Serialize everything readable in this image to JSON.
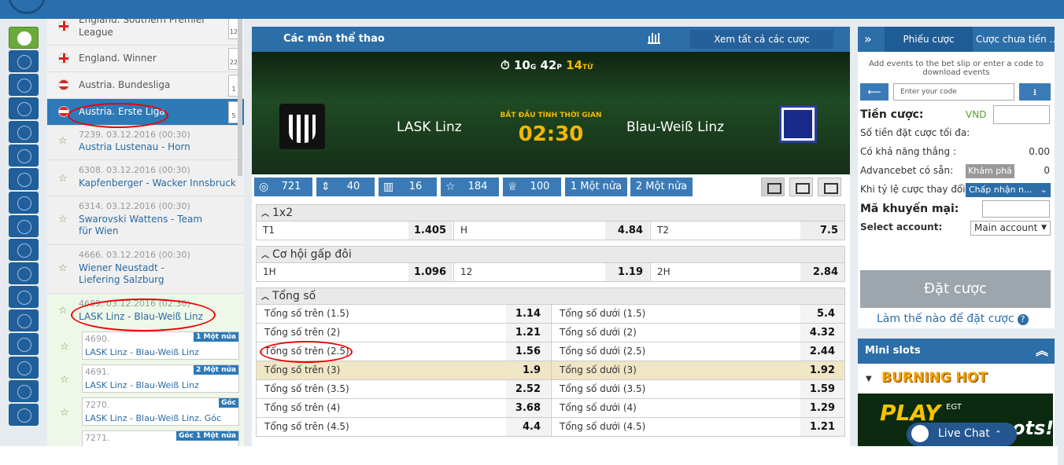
{
  "sidebar": {
    "flags": [
      "globe-icon",
      "uae-flag",
      "azerbaijan-flag",
      "belarus-flag",
      "bulgaria-flag",
      "czech-flag",
      "denmark-flag",
      "usa-flag",
      "germany-flag",
      "greece-flag",
      "england-flag",
      "spain-flag",
      "estonia-flag",
      "iran-flag",
      "finland-flag",
      "france-flag",
      "israel-flag"
    ],
    "leagues": [
      {
        "name": "England. Southern Premier League",
        "count": "12"
      },
      {
        "name": "England. Winner",
        "count": "22"
      },
      {
        "name": "Austria. Bundesliga",
        "count": "1"
      },
      {
        "name": "Austria. Erste Liga",
        "count": "5"
      }
    ],
    "matches": [
      {
        "id": "7239. 03.12.2016 (00:30)",
        "teams": "Austria Lustenau - Horn"
      },
      {
        "id": "6308. 03.12.2016 (00:30)",
        "teams": "Kapfenberger - Wacker Innsbruck"
      },
      {
        "id": "6314. 03.12.2016 (00:30)",
        "teams": "Swarovski Wattens - Team für Wien"
      },
      {
        "id": "4666. 03.12.2016 (00:30)",
        "teams": "Wiener Neustadt - Liefering Salzburg"
      },
      {
        "id": "4689. 03.12.2016 (02:30)",
        "teams": "LASK Linz - Blau-Weiß Linz"
      }
    ],
    "submarkets": [
      {
        "id": "4690.",
        "teams": "LASK Linz - Blau-Weiß Linz",
        "badge": "1 Một nửa"
      },
      {
        "id": "4691.",
        "teams": "LASK Linz - Blau-Weiß Linz",
        "badge": "2 Một nửa"
      },
      {
        "id": "7270.",
        "teams": "LASK Linz - Blau-Weiß Linz. Góc",
        "badge": "Góc"
      },
      {
        "id": "7271.",
        "teams": "",
        "badge": "Góc 1 Một nửa"
      }
    ]
  },
  "center": {
    "title": "Các môn thể thao",
    "view_all": "Xem tất cả các cược",
    "countdown": {
      "hours": "10",
      "h_unit": "G",
      "minutes": "42",
      "m_unit": "P",
      "seconds": "14",
      "s_unit": "TỪ"
    },
    "home_team": "LASK Linz",
    "away_team": "Blau-Weiß Linz",
    "start_label": "BẮT ĐẦU TÍNH THỜI GIAN",
    "start_time": "02:30",
    "tabs": [
      {
        "icon": "target-icon",
        "label": "721"
      },
      {
        "icon": "updown-icon",
        "label": "40"
      },
      {
        "icon": "bars-icon",
        "label": "16"
      },
      {
        "icon": "star-icon",
        "label": "184"
      },
      {
        "icon": "trophy-icon",
        "label": "100"
      },
      {
        "icon": "",
        "label": "1 Một nửa"
      },
      {
        "icon": "",
        "label": "2 Một nửa"
      }
    ],
    "markets": {
      "m1x2": {
        "title": "1x2",
        "cells": [
          {
            "label": "T1",
            "odd": "1.405"
          },
          {
            "label": "H",
            "odd": "4.84"
          },
          {
            "label": "T2",
            "odd": "7.5"
          }
        ]
      },
      "double": {
        "title": "Cơ hội gấp đôi",
        "cells": [
          {
            "label": "1H",
            "odd": "1.096"
          },
          {
            "label": "12",
            "odd": "1.19"
          },
          {
            "label": "2H",
            "odd": "2.84"
          }
        ]
      },
      "total": {
        "title": "Tổng số",
        "rows": [
          {
            "over": "Tổng số trên (1.5)",
            "over_odd": "1.14",
            "under": "Tổng số dưới (1.5)",
            "under_odd": "5.4"
          },
          {
            "over": "Tổng số trên (2)",
            "over_odd": "1.21",
            "under": "Tổng số dưới (2)",
            "under_odd": "4.32"
          },
          {
            "over": "Tổng số trên (2.5)",
            "over_odd": "1.56",
            "under": "Tổng số dưới (2.5)",
            "under_odd": "2.44"
          },
          {
            "over": "Tổng số trên (3)",
            "over_odd": "1.9",
            "under": "Tổng số dưới (3)",
            "under_odd": "1.92"
          },
          {
            "over": "Tổng số trên (3.5)",
            "over_odd": "2.52",
            "under": "Tổng số dưới (3.5)",
            "under_odd": "1.59"
          },
          {
            "over": "Tổng số trên (4)",
            "over_odd": "3.68",
            "under": "Tổng số dưới (4)",
            "under_odd": "1.29"
          },
          {
            "over": "Tổng số trên (4.5)",
            "over_odd": "4.4",
            "under": "Tổng số dưới (4.5)",
            "under_odd": "1.21"
          }
        ]
      }
    }
  },
  "betslip": {
    "tab1": "Phiếu cược",
    "tab2": "Cược chưa tiến ...",
    "info": "Add events to the bet slip or enter a code to download events",
    "code_placeholder": "Enter your code",
    "stake_label": "Tiền cược:",
    "currency": "VND",
    "max_label": "Số tiền đặt cược tối đa:",
    "win_label": "Có khả năng thắng :",
    "win_value": "0.00",
    "advance_label": "Advancebet có sẵn:",
    "advance_btn": "Khám phá",
    "advance_value": "0",
    "odds_change_label": "Khi tỷ lệ cược thay đổi:",
    "odds_change_value": "Chấp nhận n...",
    "promo_label": "Mã khuyến mại:",
    "account_label": "Select account:",
    "account_value": "Main account",
    "place_bet": "Đặt cược",
    "how_to": "Làm thế nào để đặt cược"
  },
  "mini": {
    "title": "Mini slots",
    "game": "BURNING HOT",
    "promo_play": "PLAY",
    "promo_brand": "EGT",
    "promo_tail": "ots!"
  },
  "chat": {
    "label": "Live Chat"
  },
  "colors": {
    "primary": "#2c6ea8",
    "accent": "#f5b800",
    "highlight_row": "#efe6c6"
  }
}
